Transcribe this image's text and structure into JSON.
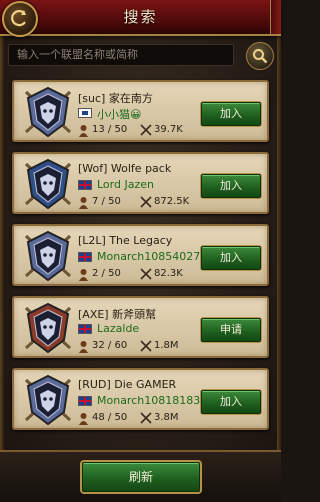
{
  "header": {
    "title": "搜索",
    "back_icon": "back-arrow-icon"
  },
  "search": {
    "placeholder": "输入一个联盟名称或简称",
    "value": "",
    "icon": "magnifier-icon"
  },
  "colors": {
    "header_red": "#7a1414",
    "card_parchment": "#e4d6b8",
    "button_green": "#1e5d1e",
    "leader_green": "#1c6b1c",
    "gold_border": "#b69246"
  },
  "alliances": [
    {
      "name": "[suc] 家在南方",
      "flag": "cn",
      "leader": "小小猫😀",
      "members": "13 / 50",
      "power": "39.7K",
      "action": "加入",
      "emblem_color": "#5a6a9a"
    },
    {
      "name": "[Wof] Wolfe pack",
      "flag": "uk",
      "leader": "Lord Jazen",
      "members": "7 / 50",
      "power": "872.5K",
      "action": "加入",
      "emblem_color": "#2e4f8a"
    },
    {
      "name": "[L2L] The Legacy",
      "flag": "uk",
      "leader": "Monarch10854027",
      "members": "2 / 50",
      "power": "82.3K",
      "action": "加入",
      "emblem_color": "#5a6a9a"
    },
    {
      "name": "[AXE] 新斧頭幫",
      "flag": "uk",
      "leader": "Lazalde",
      "members": "32 / 60",
      "power": "1.8M",
      "action": "申请",
      "emblem_color": "#8a3a2a"
    },
    {
      "name": "[RUD] Die GAMER",
      "flag": "uk",
      "leader": "Monarch10818183",
      "members": "48 / 50",
      "power": "3.8M",
      "action": "加入",
      "emblem_color": "#5a6a9a"
    }
  ],
  "footer": {
    "refresh_label": "刷新"
  }
}
